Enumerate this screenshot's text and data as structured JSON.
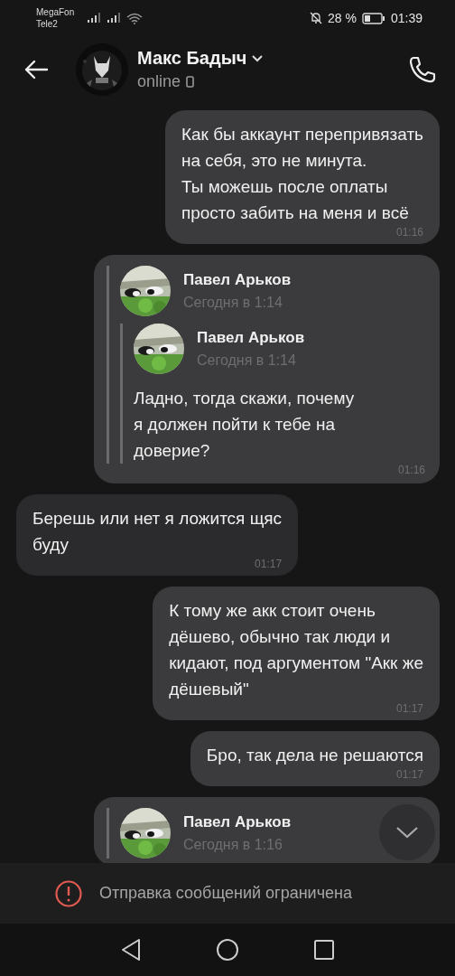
{
  "status_bar": {
    "carriers": [
      "MegaFon",
      "Tele2"
    ],
    "battery_text": "28 %",
    "time": "01:39"
  },
  "header": {
    "name": "Макс Бадыч",
    "status": "online"
  },
  "messages": [
    {
      "kind": "text",
      "outgoing": true,
      "text": "Как бы аккаунт перепривязать\nна себя, это не минута.\nТы можешь после оплаты\nпросто забить на меня и всё",
      "time": "01:16"
    },
    {
      "kind": "forward",
      "outgoing": true,
      "time": "01:16",
      "forward": {
        "name": "Павел Арьков",
        "date": "Сегодня в 1:14",
        "forward": {
          "name": "Павел Арьков",
          "date": "Сегодня в 1:14",
          "text": "Ладно, тогда скажи, почему\nя должен пойти к тебе на\nдоверие?"
        }
      }
    },
    {
      "kind": "text",
      "outgoing": false,
      "text": "Берешь или нет я ложится щяс\nбуду",
      "time": "01:17"
    },
    {
      "kind": "text",
      "outgoing": true,
      "text": "К тому же акк стоит очень\nдёшево, обычно так люди и\nкидают, под аргументом \"Акк же\nдёшевый\"",
      "time": "01:17"
    },
    {
      "kind": "text",
      "outgoing": true,
      "text": "Бро, так дела не решаются",
      "time": "01:17"
    },
    {
      "kind": "forward",
      "outgoing": true,
      "forward": {
        "name": "Павел Арьков",
        "date": "Сегодня в 1:16"
      }
    }
  ],
  "notice": "Отправка сообщений ограничена"
}
